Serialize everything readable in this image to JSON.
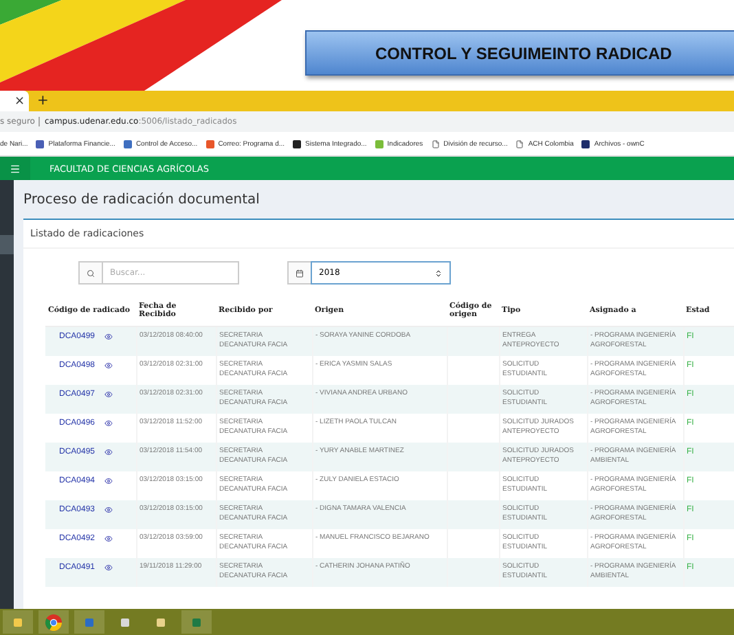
{
  "banner": {
    "title": "CONTROL Y SEGUIMEINTO RADICAD"
  },
  "browser": {
    "tabs": [
      {
        "close": "×",
        "selected": true
      }
    ],
    "new_tab": "+",
    "address": {
      "security": "s seguro",
      "host": "campus.udenar.edu.co",
      "path": ":5006/listado_radicados"
    },
    "bookmarks": [
      {
        "label": "de Nari...",
        "kind": "none"
      },
      {
        "label": "Plataforma Financie...",
        "kind": "shield"
      },
      {
        "label": "Control de Acceso...",
        "kind": "bars"
      },
      {
        "label": "Correo: Programa d...",
        "kind": "tiles"
      },
      {
        "label": "Sistema Integrado...",
        "kind": "dark"
      },
      {
        "label": "Indicadores",
        "kind": "check"
      },
      {
        "label": "División de recurso...",
        "kind": "page"
      },
      {
        "label": "ACH Colombia",
        "kind": "page"
      },
      {
        "label": "Archivos - ownC",
        "kind": "cloud"
      }
    ]
  },
  "app_bar": {
    "title": "FACULTAD DE CIENCIAS AGRÍCOLAS"
  },
  "page": {
    "title": "Proceso de radicación documental",
    "card_title": "Listado de radicaciones",
    "search": {
      "placeholder": "Buscar..."
    },
    "year": {
      "value": "2018"
    }
  },
  "table": {
    "columns": [
      "Código de radicado",
      "Fecha de Recibido",
      "Recibido por",
      "Origen",
      "Código de origen",
      "Tipo",
      "Asignado a",
      "Estad"
    ],
    "rows": [
      {
        "code": "DCA0499",
        "received": "03/12/2018 08:40:00",
        "received_by": "SECRETARIA DECANATURA FACIA",
        "origin": "- SORAYA YANINE CORDOBA",
        "type": "ENTREGA ANTEPROYECTO",
        "assigned": "- PROGRAMA INGENIERÍA AGROFORESTAL",
        "status": "FI"
      },
      {
        "code": "DCA0498",
        "received": "03/12/2018 02:31:00",
        "received_by": "SECRETARIA DECANATURA FACIA",
        "origin": "- ERICA YASMIN SALAS",
        "type": "SOLICITUD ESTUDIANTIL",
        "assigned": "- PROGRAMA INGENIERÍA AGROFORESTAL",
        "status": "FI"
      },
      {
        "code": "DCA0497",
        "received": "03/12/2018 02:31:00",
        "received_by": "SECRETARIA DECANATURA FACIA",
        "origin": "- VIVIANA ANDREA URBANO",
        "type": "SOLICITUD ESTUDIANTIL",
        "assigned": "- PROGRAMA INGENIERÍA AGROFORESTAL",
        "status": "FI"
      },
      {
        "code": "DCA0496",
        "received": "03/12/2018 11:52:00",
        "received_by": "SECRETARIA DECANATURA FACIA",
        "origin": "- LIZETH PAOLA TULCAN",
        "type": "SOLICITUD JURADOS ANTEPROYECTO",
        "assigned": "- PROGRAMA INGENIERÍA AGROFORESTAL",
        "status": "FI"
      },
      {
        "code": "DCA0495",
        "received": "03/12/2018 11:54:00",
        "received_by": "SECRETARIA DECANATURA FACIA",
        "origin": "- YURY ANABLE MARTINEZ",
        "type": "SOLICITUD JURADOS ANTEPROYECTO",
        "assigned": "- PROGRAMA INGENIERÍA AMBIENTAL",
        "status": "FI"
      },
      {
        "code": "DCA0494",
        "received": "03/12/2018 03:15:00",
        "received_by": "SECRETARIA DECANATURA FACIA",
        "origin": "- ZULY DANIELA ESTACIO",
        "type": "SOLICITUD ESTUDIANTIL",
        "assigned": "- PROGRAMA INGENIERÍA AGROFORESTAL",
        "status": "FI"
      },
      {
        "code": "DCA0493",
        "received": "03/12/2018 03:15:00",
        "received_by": "SECRETARIA DECANATURA FACIA",
        "origin": "- DIGNA TAMARA VALENCIA",
        "type": "SOLICITUD ESTUDIANTIL",
        "assigned": "- PROGRAMA INGENIERÍA AGROFORESTAL",
        "status": "FI"
      },
      {
        "code": "DCA0492",
        "received": "03/12/2018 03:59:00",
        "received_by": "SECRETARIA DECANATURA FACIA",
        "origin": "- MANUEL FRANCISCO BEJARANO",
        "type": "SOLICITUD ESTUDIANTIL",
        "assigned": "- PROGRAMA INGENIERÍA AGROFORESTAL",
        "status": "FI"
      },
      {
        "code": "DCA0491",
        "received": "19/11/2018 11:29:00",
        "received_by": "SECRETARIA DECANATURA FACIA",
        "origin": "- CATHERIN JOHANA PATIÑO",
        "type": "SOLICITUD ESTUDIANTIL",
        "assigned": "- PROGRAMA INGENIERÍA AMBIENTAL",
        "status": "FI"
      }
    ]
  }
}
